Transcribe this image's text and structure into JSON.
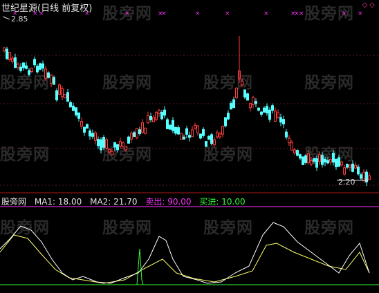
{
  "title": "世纪星源(日线 前复权)",
  "price_high_label": "2.85",
  "price_low_label": "2.20",
  "watermark": "股旁网",
  "indicator": {
    "name": "股旁网",
    "ma1_label": "MA1: 18.00",
    "ma2_label": "MA2: 21.70",
    "sell_label": "卖出: 90.00",
    "buy_label": "买进: 10.00"
  },
  "colors": {
    "background": "#000000",
    "bull": "#ff3c3c",
    "bear": "#55ffff",
    "ma1": "#ffffff",
    "ma2": "#ffff66",
    "sell": "#ff33ff",
    "buy": "#33ff33",
    "grid": "#7a1f1f"
  }
}
